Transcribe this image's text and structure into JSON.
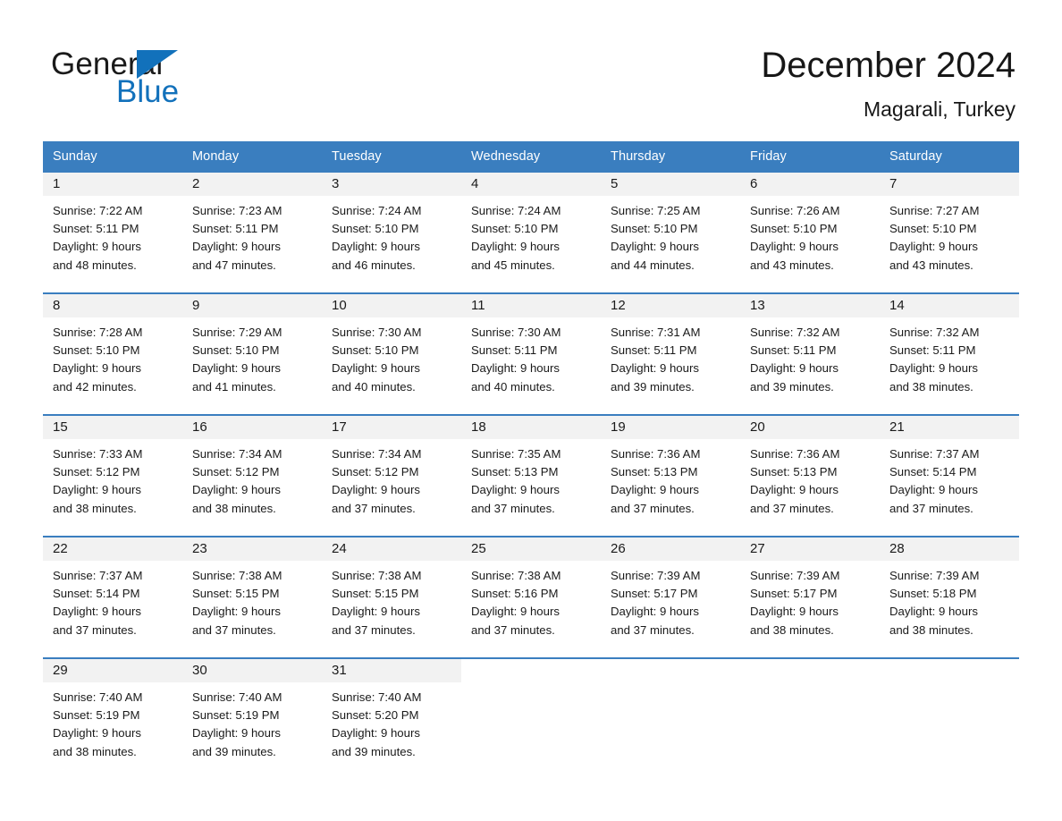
{
  "brand": {
    "name_part1": "General",
    "name_part2": "Blue",
    "triangle_color": "#1271bb",
    "accent_color": "#3a7ebf"
  },
  "header": {
    "title": "December 2024",
    "location": "Magarali, Turkey"
  },
  "calendar": {
    "weekday_headers": [
      "Sunday",
      "Monday",
      "Tuesday",
      "Wednesday",
      "Thursday",
      "Friday",
      "Saturday"
    ],
    "header_bg": "#3a7ebf",
    "daynum_bg": "#f2f2f2",
    "weeks": [
      [
        {
          "day": "1",
          "sunrise": "Sunrise: 7:22 AM",
          "sunset": "Sunset: 5:11 PM",
          "daylight_line1": "Daylight: 9 hours",
          "daylight_line2": "and 48 minutes."
        },
        {
          "day": "2",
          "sunrise": "Sunrise: 7:23 AM",
          "sunset": "Sunset: 5:11 PM",
          "daylight_line1": "Daylight: 9 hours",
          "daylight_line2": "and 47 minutes."
        },
        {
          "day": "3",
          "sunrise": "Sunrise: 7:24 AM",
          "sunset": "Sunset: 5:10 PM",
          "daylight_line1": "Daylight: 9 hours",
          "daylight_line2": "and 46 minutes."
        },
        {
          "day": "4",
          "sunrise": "Sunrise: 7:24 AM",
          "sunset": "Sunset: 5:10 PM",
          "daylight_line1": "Daylight: 9 hours",
          "daylight_line2": "and 45 minutes."
        },
        {
          "day": "5",
          "sunrise": "Sunrise: 7:25 AM",
          "sunset": "Sunset: 5:10 PM",
          "daylight_line1": "Daylight: 9 hours",
          "daylight_line2": "and 44 minutes."
        },
        {
          "day": "6",
          "sunrise": "Sunrise: 7:26 AM",
          "sunset": "Sunset: 5:10 PM",
          "daylight_line1": "Daylight: 9 hours",
          "daylight_line2": "and 43 minutes."
        },
        {
          "day": "7",
          "sunrise": "Sunrise: 7:27 AM",
          "sunset": "Sunset: 5:10 PM",
          "daylight_line1": "Daylight: 9 hours",
          "daylight_line2": "and 43 minutes."
        }
      ],
      [
        {
          "day": "8",
          "sunrise": "Sunrise: 7:28 AM",
          "sunset": "Sunset: 5:10 PM",
          "daylight_line1": "Daylight: 9 hours",
          "daylight_line2": "and 42 minutes."
        },
        {
          "day": "9",
          "sunrise": "Sunrise: 7:29 AM",
          "sunset": "Sunset: 5:10 PM",
          "daylight_line1": "Daylight: 9 hours",
          "daylight_line2": "and 41 minutes."
        },
        {
          "day": "10",
          "sunrise": "Sunrise: 7:30 AM",
          "sunset": "Sunset: 5:10 PM",
          "daylight_line1": "Daylight: 9 hours",
          "daylight_line2": "and 40 minutes."
        },
        {
          "day": "11",
          "sunrise": "Sunrise: 7:30 AM",
          "sunset": "Sunset: 5:11 PM",
          "daylight_line1": "Daylight: 9 hours",
          "daylight_line2": "and 40 minutes."
        },
        {
          "day": "12",
          "sunrise": "Sunrise: 7:31 AM",
          "sunset": "Sunset: 5:11 PM",
          "daylight_line1": "Daylight: 9 hours",
          "daylight_line2": "and 39 minutes."
        },
        {
          "day": "13",
          "sunrise": "Sunrise: 7:32 AM",
          "sunset": "Sunset: 5:11 PM",
          "daylight_line1": "Daylight: 9 hours",
          "daylight_line2": "and 39 minutes."
        },
        {
          "day": "14",
          "sunrise": "Sunrise: 7:32 AM",
          "sunset": "Sunset: 5:11 PM",
          "daylight_line1": "Daylight: 9 hours",
          "daylight_line2": "and 38 minutes."
        }
      ],
      [
        {
          "day": "15",
          "sunrise": "Sunrise: 7:33 AM",
          "sunset": "Sunset: 5:12 PM",
          "daylight_line1": "Daylight: 9 hours",
          "daylight_line2": "and 38 minutes."
        },
        {
          "day": "16",
          "sunrise": "Sunrise: 7:34 AM",
          "sunset": "Sunset: 5:12 PM",
          "daylight_line1": "Daylight: 9 hours",
          "daylight_line2": "and 38 minutes."
        },
        {
          "day": "17",
          "sunrise": "Sunrise: 7:34 AM",
          "sunset": "Sunset: 5:12 PM",
          "daylight_line1": "Daylight: 9 hours",
          "daylight_line2": "and 37 minutes."
        },
        {
          "day": "18",
          "sunrise": "Sunrise: 7:35 AM",
          "sunset": "Sunset: 5:13 PM",
          "daylight_line1": "Daylight: 9 hours",
          "daylight_line2": "and 37 minutes."
        },
        {
          "day": "19",
          "sunrise": "Sunrise: 7:36 AM",
          "sunset": "Sunset: 5:13 PM",
          "daylight_line1": "Daylight: 9 hours",
          "daylight_line2": "and 37 minutes."
        },
        {
          "day": "20",
          "sunrise": "Sunrise: 7:36 AM",
          "sunset": "Sunset: 5:13 PM",
          "daylight_line1": "Daylight: 9 hours",
          "daylight_line2": "and 37 minutes."
        },
        {
          "day": "21",
          "sunrise": "Sunrise: 7:37 AM",
          "sunset": "Sunset: 5:14 PM",
          "daylight_line1": "Daylight: 9 hours",
          "daylight_line2": "and 37 minutes."
        }
      ],
      [
        {
          "day": "22",
          "sunrise": "Sunrise: 7:37 AM",
          "sunset": "Sunset: 5:14 PM",
          "daylight_line1": "Daylight: 9 hours",
          "daylight_line2": "and 37 minutes."
        },
        {
          "day": "23",
          "sunrise": "Sunrise: 7:38 AM",
          "sunset": "Sunset: 5:15 PM",
          "daylight_line1": "Daylight: 9 hours",
          "daylight_line2": "and 37 minutes."
        },
        {
          "day": "24",
          "sunrise": "Sunrise: 7:38 AM",
          "sunset": "Sunset: 5:15 PM",
          "daylight_line1": "Daylight: 9 hours",
          "daylight_line2": "and 37 minutes."
        },
        {
          "day": "25",
          "sunrise": "Sunrise: 7:38 AM",
          "sunset": "Sunset: 5:16 PM",
          "daylight_line1": "Daylight: 9 hours",
          "daylight_line2": "and 37 minutes."
        },
        {
          "day": "26",
          "sunrise": "Sunrise: 7:39 AM",
          "sunset": "Sunset: 5:17 PM",
          "daylight_line1": "Daylight: 9 hours",
          "daylight_line2": "and 37 minutes."
        },
        {
          "day": "27",
          "sunrise": "Sunrise: 7:39 AM",
          "sunset": "Sunset: 5:17 PM",
          "daylight_line1": "Daylight: 9 hours",
          "daylight_line2": "and 38 minutes."
        },
        {
          "day": "28",
          "sunrise": "Sunrise: 7:39 AM",
          "sunset": "Sunset: 5:18 PM",
          "daylight_line1": "Daylight: 9 hours",
          "daylight_line2": "and 38 minutes."
        }
      ],
      [
        {
          "day": "29",
          "sunrise": "Sunrise: 7:40 AM",
          "sunset": "Sunset: 5:19 PM",
          "daylight_line1": "Daylight: 9 hours",
          "daylight_line2": "and 38 minutes."
        },
        {
          "day": "30",
          "sunrise": "Sunrise: 7:40 AM",
          "sunset": "Sunset: 5:19 PM",
          "daylight_line1": "Daylight: 9 hours",
          "daylight_line2": "and 39 minutes."
        },
        {
          "day": "31",
          "sunrise": "Sunrise: 7:40 AM",
          "sunset": "Sunset: 5:20 PM",
          "daylight_line1": "Daylight: 9 hours",
          "daylight_line2": "and 39 minutes."
        },
        {
          "day": "",
          "sunrise": "",
          "sunset": "",
          "daylight_line1": "",
          "daylight_line2": ""
        },
        {
          "day": "",
          "sunrise": "",
          "sunset": "",
          "daylight_line1": "",
          "daylight_line2": ""
        },
        {
          "day": "",
          "sunrise": "",
          "sunset": "",
          "daylight_line1": "",
          "daylight_line2": ""
        },
        {
          "day": "",
          "sunrise": "",
          "sunset": "",
          "daylight_line1": "",
          "daylight_line2": ""
        }
      ]
    ]
  }
}
